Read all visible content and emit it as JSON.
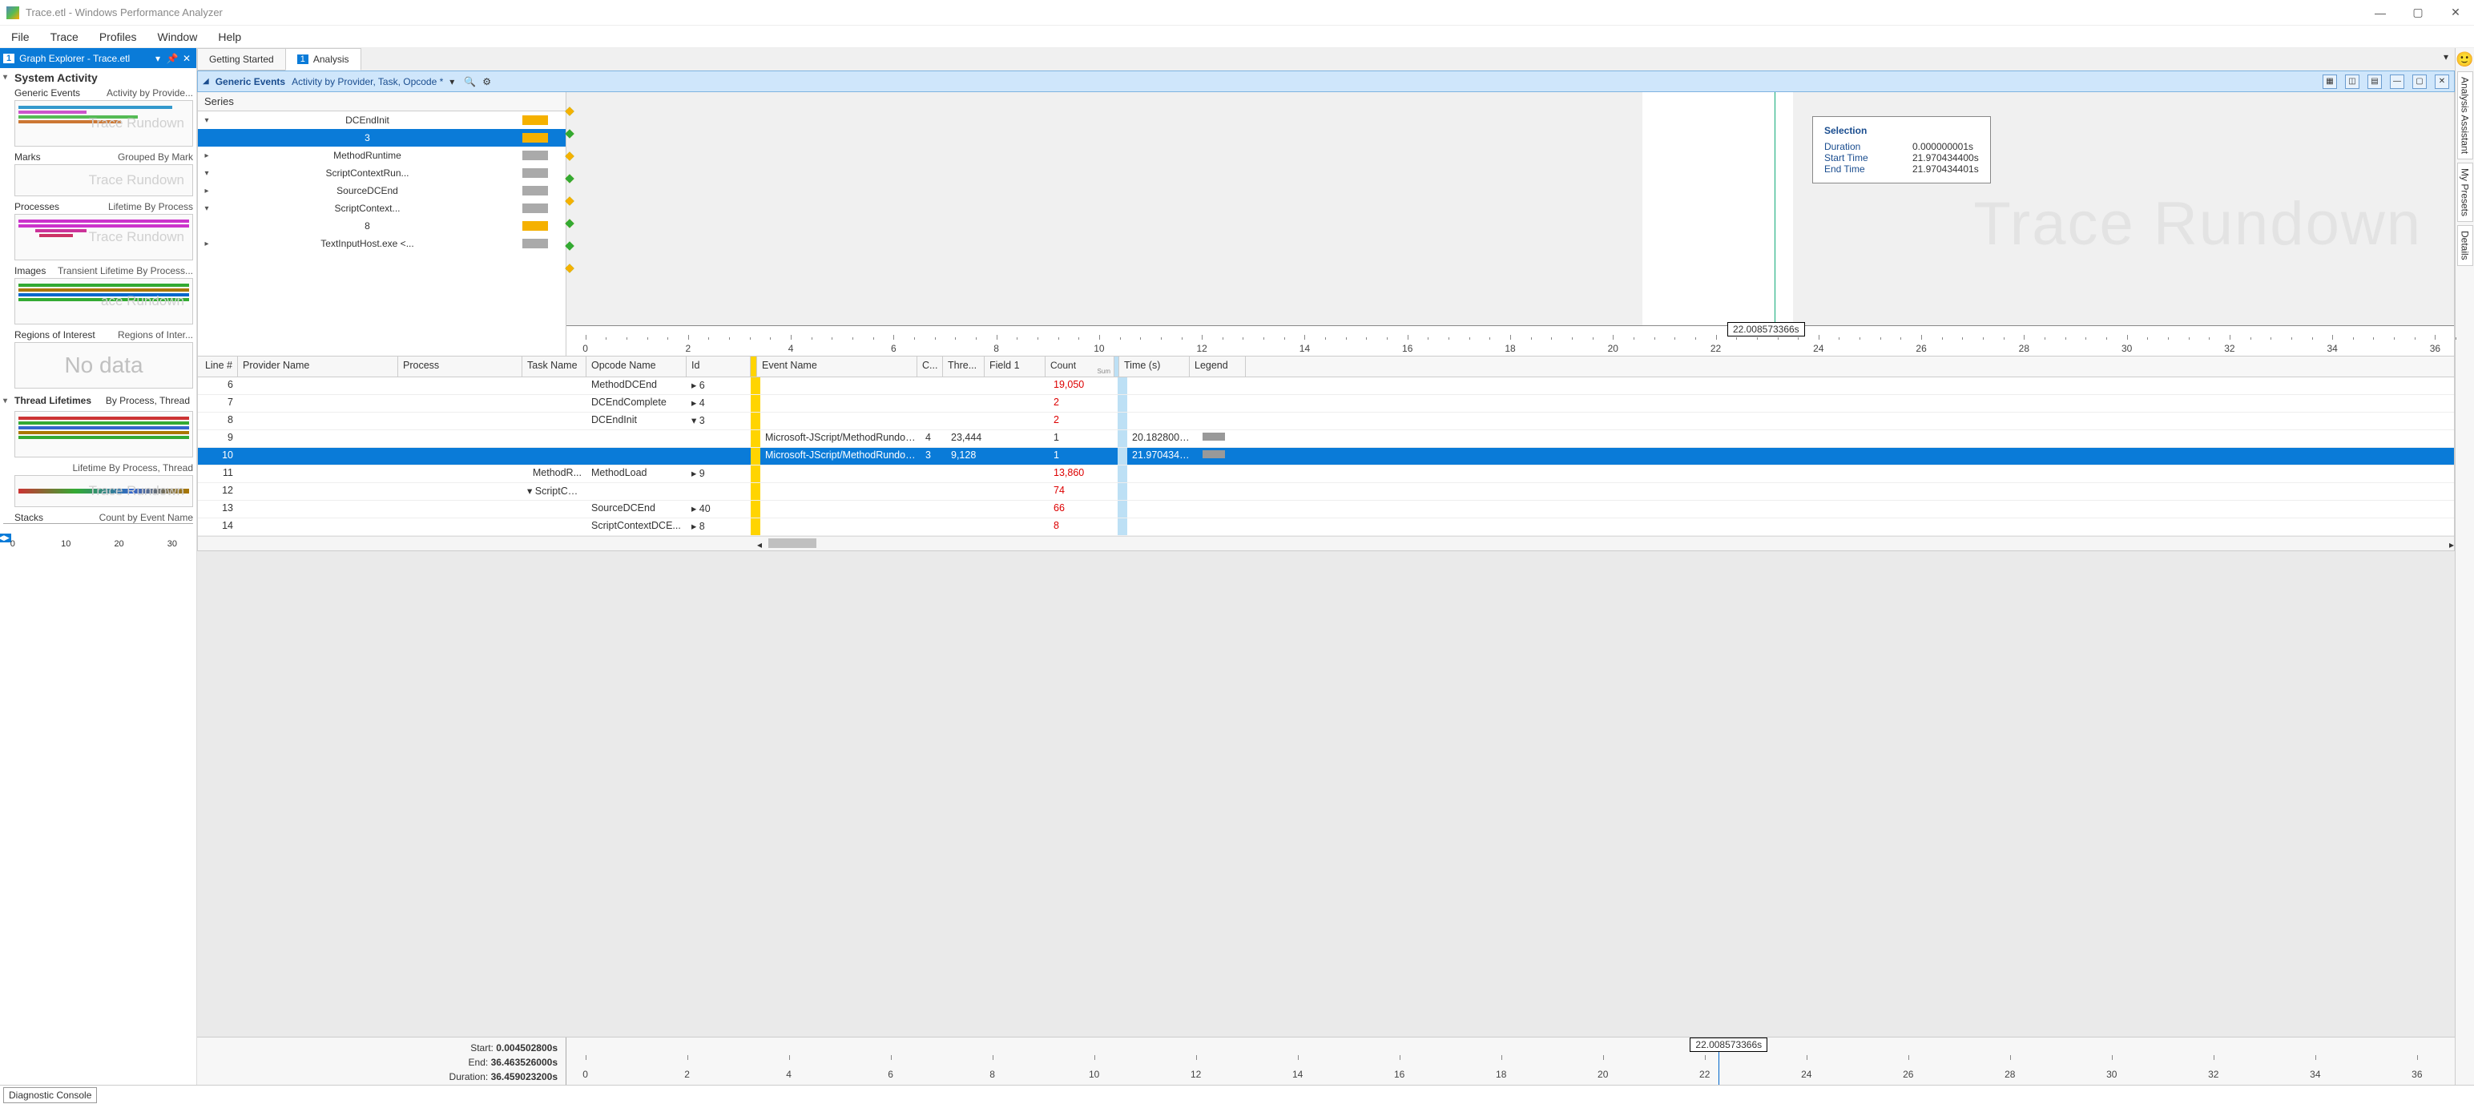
{
  "window": {
    "title": "Trace.etl - Windows Performance Analyzer"
  },
  "menu": [
    "File",
    "Trace",
    "Profiles",
    "Window",
    "Help"
  ],
  "leftPanel": {
    "header": "Graph Explorer - Trace.etl",
    "headerNum": "1",
    "sections": {
      "system": {
        "title": "System Activity"
      },
      "generic": {
        "l": "Generic Events",
        "r": "Activity by Provide...",
        "wm": "Trace Rundown"
      },
      "marks": {
        "l": "Marks",
        "r": "Grouped By Mark",
        "wm": "Trace Rundown"
      },
      "processes": {
        "l": "Processes",
        "r": "Lifetime By Process",
        "wm": "Trace Rundown"
      },
      "images": {
        "l": "Images",
        "r": "Transient Lifetime By Process...",
        "wm": "ace Rundown"
      },
      "regions": {
        "l": "Regions of Interest",
        "r": "Regions of Inter...",
        "nodata": "No data"
      },
      "threads": {
        "l": "Thread Lifetimes",
        "r": "By Process, Thread"
      },
      "threads2": {
        "l": "",
        "r": "Lifetime By Process, Thread",
        "wm": "Trace Rundown"
      },
      "stacks": {
        "l": "Stacks",
        "r": "Count by Event Name"
      }
    },
    "miniRuler": [
      "0",
      "10",
      "20",
      "30"
    ]
  },
  "tabs": {
    "t1": "Getting Started",
    "t2": "Analysis",
    "t2num": "1"
  },
  "graphHeader": {
    "title": "Generic Events",
    "sub": "Activity by Provider, Task, Opcode *"
  },
  "series": {
    "label": "Series",
    "rows": [
      {
        "exp": "▾",
        "label": "DCEndInit",
        "chip": "#f5b100"
      },
      {
        "exp": "",
        "label": "3",
        "chip": "#f5b100",
        "sel": true
      },
      {
        "exp": "▸",
        "label": "MethodRuntime",
        "chip": "#aaa"
      },
      {
        "exp": "▾",
        "label": "ScriptContextRun...",
        "chip": "#aaa"
      },
      {
        "exp": "▸",
        "label": "SourceDCEnd",
        "chip": "#aaa"
      },
      {
        "exp": "▾",
        "label": "ScriptContext...",
        "chip": "#aaa"
      },
      {
        "exp": "",
        "label": "8",
        "chip": "#f5b100"
      },
      {
        "exp": "▸",
        "label": "TextInputHost.exe <...",
        "chip": "#aaa"
      }
    ]
  },
  "timeline": {
    "ticks": [
      "0",
      "2",
      "4",
      "6",
      "8",
      "10",
      "12",
      "14",
      "16",
      "18",
      "20",
      "22",
      "24",
      "26",
      "28",
      "30",
      "32",
      "34",
      "36"
    ],
    "bubble": "22.008573366s",
    "watermark": "Trace Rundown"
  },
  "tooltip": {
    "title": "Selection",
    "rows": [
      {
        "k": "Duration",
        "v": "0.000000001s"
      },
      {
        "k": "Start Time",
        "v": "21.970434400s"
      },
      {
        "k": "End Time",
        "v": "21.970434401s"
      }
    ]
  },
  "tableHead": [
    "Line #",
    "Provider Name",
    "Process",
    "Task Name",
    "Opcode Name",
    "Id",
    "Event Name",
    "C...",
    "Thre...",
    "Field 1",
    "Count",
    "Time (s)",
    "Legend"
  ],
  "countSum": "Sum",
  "rows": [
    {
      "ln": "6",
      "op": "MethodDCEnd",
      "id": "▸ 6",
      "count": "19,050",
      "red": true
    },
    {
      "ln": "7",
      "op": "DCEndComplete",
      "id": "▸ 4",
      "count": "2",
      "red": true
    },
    {
      "ln": "8",
      "op": "DCEndInit",
      "id": "▾ 3",
      "count": "2",
      "red": true
    },
    {
      "ln": "9",
      "event": "Microsoft-JScript/MethodRundow...",
      "c": "4",
      "thre": "23,444",
      "count": "1",
      "time": "20.182800600",
      "leg": true
    },
    {
      "ln": "10",
      "event": "Microsoft-JScript/MethodRundow...",
      "c": "3",
      "thre": "9,128",
      "count": "1",
      "time": "21.970434400",
      "sel": true,
      "leg": true
    },
    {
      "ln": "11",
      "task": "MethodR...",
      "op": "MethodLoad",
      "id": "▸ 9",
      "count": "13,860",
      "red": true
    },
    {
      "ln": "12",
      "task": "▾ ScriptCo...",
      "count": "74",
      "red": true
    },
    {
      "ln": "13",
      "op": "SourceDCEnd",
      "id": "▸ 40",
      "count": "66",
      "red": true
    },
    {
      "ln": "14",
      "op": "ScriptContextDCE...",
      "id": "▸ 8",
      "count": "8",
      "red": true
    }
  ],
  "bottomRuler": {
    "start_l": "Start:",
    "start_v": "0.004502800s",
    "end_l": "End:",
    "end_v": "36.463526000s",
    "dur_l": "Duration:",
    "dur_v": "36.459023200s",
    "bubble": "22.008573366s",
    "ticks": [
      "0",
      "2",
      "4",
      "6",
      "8",
      "10",
      "12",
      "14",
      "16",
      "18",
      "20",
      "22",
      "24",
      "26",
      "28",
      "30",
      "32",
      "34",
      "36"
    ]
  },
  "statusBar": {
    "diag": "Diagnostic Console"
  },
  "rightTabs": [
    "Analysis Assistant",
    "My Presets",
    "Details"
  ]
}
